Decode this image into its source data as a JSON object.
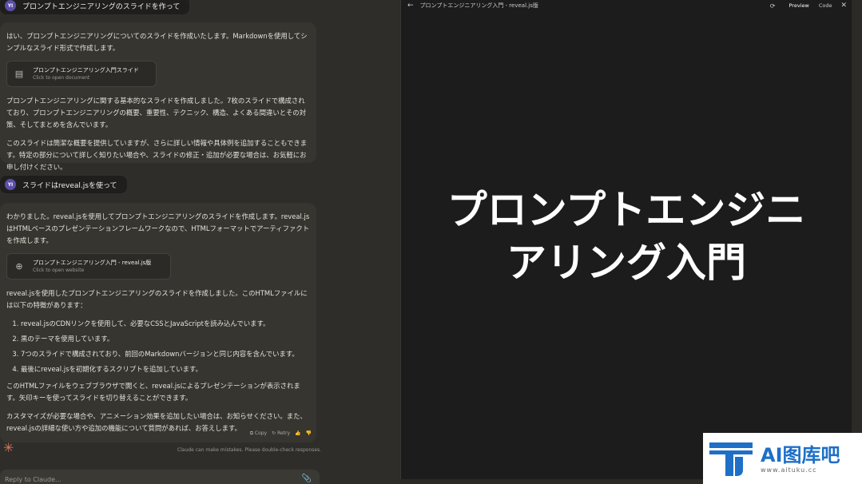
{
  "conversation": {
    "user_messages": [
      {
        "avatar": "YI",
        "text": "プロンプトエンジニアリングのスライドを作って"
      },
      {
        "avatar": "YI",
        "text": "スライドはreveal.jsを使って"
      }
    ],
    "assistant_1": {
      "intro": "はい、プロンプトエンジニアリングについてのスライドを作成いたします。Markdownを使用してシンプルなスライド形式で作成します。",
      "card_title": "プロンプトエンジニアリング入門スライド",
      "card_sub": "Click to open document",
      "p1": "プロンプトエンジニアリングに関する基本的なスライドを作成しました。7枚のスライドで構成されており、プロンプトエンジニアリングの概要、重要性、テクニック、構造、よくある間違いとその対策、そしてまとめを含んでいます。",
      "p2": "このスライドは簡潔な概要を提供していますが、さらに詳しい情報や具体例を追加することもできます。特定の部分について詳しく知りたい場合や、スライドの修正・追加が必要な場合は、お気軽にお申し付けください。"
    },
    "assistant_2": {
      "intro": "わかりました。reveal.jsを使用してプロンプトエンジニアリングのスライドを作成します。reveal.jsはHTMLベースのプレゼンテーションフレームワークなので、HTMLフォーマットでアーティファクトを作成します。",
      "card_title": "プロンプトエンジニアリング入門 - reveal.js版",
      "card_sub": "Click to open website",
      "p1": "reveal.jsを使用したプロンプトエンジニアリングのスライドを作成しました。このHTMLファイルには以下の特徴があります：",
      "list": [
        "reveal.jsのCDNリンクを使用して、必要なCSSとJavaScriptを読み込んでいます。",
        "黒のテーマを使用しています。",
        "7つのスライドで構成されており、前回のMarkdownバージョンと同じ内容を含んでいます。",
        "最後にreveal.jsを初期化するスクリプトを追加しています。"
      ],
      "p2": "このHTMLファイルをウェブブラウザで開くと、reveal.jsによるプレゼンテーションが表示されます。矢印キーを使ってスライドを切り替えることができます。",
      "p3": "カスタマイズが必要な場合や、アニメーション効果を追加したい場合は、お知らせください。また、reveal.jsの詳細な使い方や追加の機能について質問があれば、お答えします。",
      "actions": {
        "copy": "Copy",
        "retry": "Retry"
      }
    },
    "disclaimer": "Claude can make mistakes. Please double-check responses.",
    "reply_placeholder": "Reply to Claude..."
  },
  "artifact": {
    "title": "プロンプトエンジニアリング入門 - reveal.js版",
    "tabs": {
      "preview": "Preview",
      "code": "Code"
    },
    "slide_title_line1": "プロンプトエンジニ",
    "slide_title_line2": "アリング入門"
  },
  "watermark": {
    "brand": "AI图库吧",
    "url": "www.aituku.cc"
  },
  "colors": {
    "avatar": "#5b4ea8",
    "claude_orange": "#d97757",
    "watermark_blue": "#1e6fc7"
  }
}
